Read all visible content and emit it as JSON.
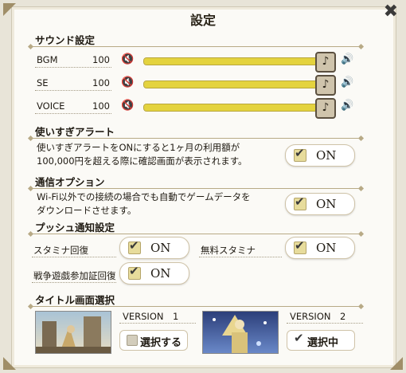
{
  "title": "設定",
  "close_glyph": "✖",
  "sound": {
    "header": "サウンド設定",
    "rows": [
      {
        "label": "BGM",
        "value": "100",
        "level": 1.0
      },
      {
        "label": "SE",
        "value": "100",
        "level": 1.0
      },
      {
        "label": "VOICE",
        "value": "100",
        "level": 1.0
      }
    ]
  },
  "overuse": {
    "header": "使いすぎアラート",
    "desc_line1": "使いすぎアラートをONにすると1ヶ月の利用額が",
    "desc_line2": "100,000円を超える際に確認画面が表示されます。",
    "toggle": "ON"
  },
  "comm": {
    "header": "通信オプション",
    "desc_line1": "Wi-Fi以外での接続の場合でも自動でゲームデータを",
    "desc_line2": "ダウンロードさせます。",
    "toggle": "ON"
  },
  "push": {
    "header": "プッシュ通知設定",
    "items": [
      {
        "label": "スタミナ回復",
        "toggle": "ON"
      },
      {
        "label": "無料スタミナ",
        "toggle": "ON"
      },
      {
        "label": "戦争遊戯参加証回復",
        "toggle": "ON"
      }
    ]
  },
  "title_screen": {
    "header": "タイトル画面選択",
    "versions": [
      {
        "name": "VERSION　1",
        "button": "選択する",
        "selected": false
      },
      {
        "name": "VERSION　2",
        "button": "選択中",
        "selected": true
      }
    ]
  },
  "icons": {
    "mute": "🔇",
    "volume": "🔊",
    "knob": "♪",
    "check": "✔"
  },
  "colors": {
    "slider_fill": "#e4d33e",
    "accent": "#a08e68"
  }
}
